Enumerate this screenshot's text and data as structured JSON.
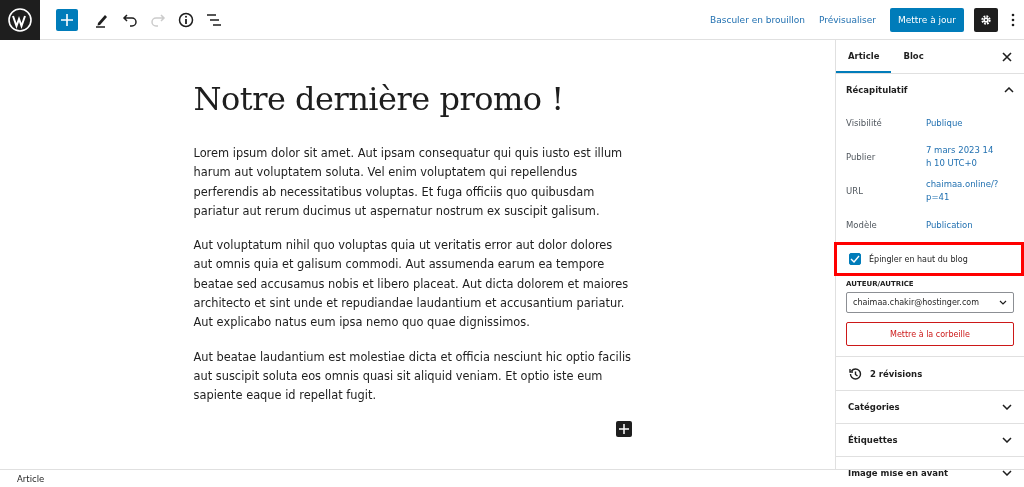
{
  "toolbar": {
    "tools": [
      {
        "kind": "add",
        "disabled": false
      },
      {
        "kind": "edit",
        "disabled": false
      },
      {
        "kind": "undo",
        "disabled": false
      },
      {
        "kind": "redo",
        "disabled": true
      },
      {
        "kind": "info",
        "disabled": false
      },
      {
        "kind": "list",
        "disabled": false
      }
    ],
    "actions": [
      {
        "kind": "link",
        "label": "Basculer en brouillon"
      },
      {
        "kind": "link",
        "label": "Prévisualiser"
      },
      {
        "kind": "primary",
        "label": "Mettre à jour"
      }
    ]
  },
  "editor": {
    "title": "Notre dernière promo !",
    "paragraphs": [
      "Lorem ipsum dolor sit amet. Aut ipsam consequatur qui quis iusto est illum harum aut voluptatem soluta. Vel enim voluptatem qui repellendus perferendis ab necessitatibus voluptas. Et fuga officiis quo quibusdam pariatur aut rerum ducimus ut aspernatur nostrum ex suscipit galisum.",
      "Aut voluptatum nihil quo voluptas quia ut veritatis error aut dolor dolores aut omnis quia et galisum commodi. Aut assumenda earum ea tempore beatae sed accusamus nobis et libero placeat. Aut dicta dolorem et maiores architecto et sint unde et repudiandae laudantium et accusantium pariatur. Aut explicabo natus eum ipsa nemo quo quae dignissimos.",
      "Aut beatae laudantium est molestiae dicta et officia nesciunt hic optio facilis aut suscipit soluta eos omnis quasi sit aliquid veniam. Et optio iste eum sapiente eaque id repellat fugit."
    ]
  },
  "sidebar": {
    "tabs": [
      {
        "label": "Article",
        "selected": true
      },
      {
        "label": "Bloc",
        "selected": false
      }
    ],
    "summary": {
      "title": "Récapitulatif",
      "expanded": true,
      "rows": [
        {
          "label": "Visibilité",
          "value": "Publique"
        },
        {
          "label": "Publier",
          "value": "7 mars 2023 14 h 10 UTC+0"
        },
        {
          "label": "URL",
          "value": "chaimaa.online/?p=41"
        },
        {
          "label": "Modèle",
          "value": "Publication"
        }
      ],
      "sticky": {
        "label": "Épingler en haut du blog",
        "checked": true,
        "highlighted": true
      },
      "author_label": "AUTEUR/AUTRICE",
      "author": "chaimaa.chakir@hostinger.com",
      "trash": "Mettre à la corbeille"
    },
    "revisions": "2 révisions",
    "panels": [
      {
        "title": "Catégories",
        "expanded": false
      },
      {
        "title": "Étiquettes",
        "expanded": false
      },
      {
        "title": "Image mise en avant",
        "expanded": false
      }
    ]
  },
  "status_bar": {
    "breadcrumb": "Article"
  }
}
